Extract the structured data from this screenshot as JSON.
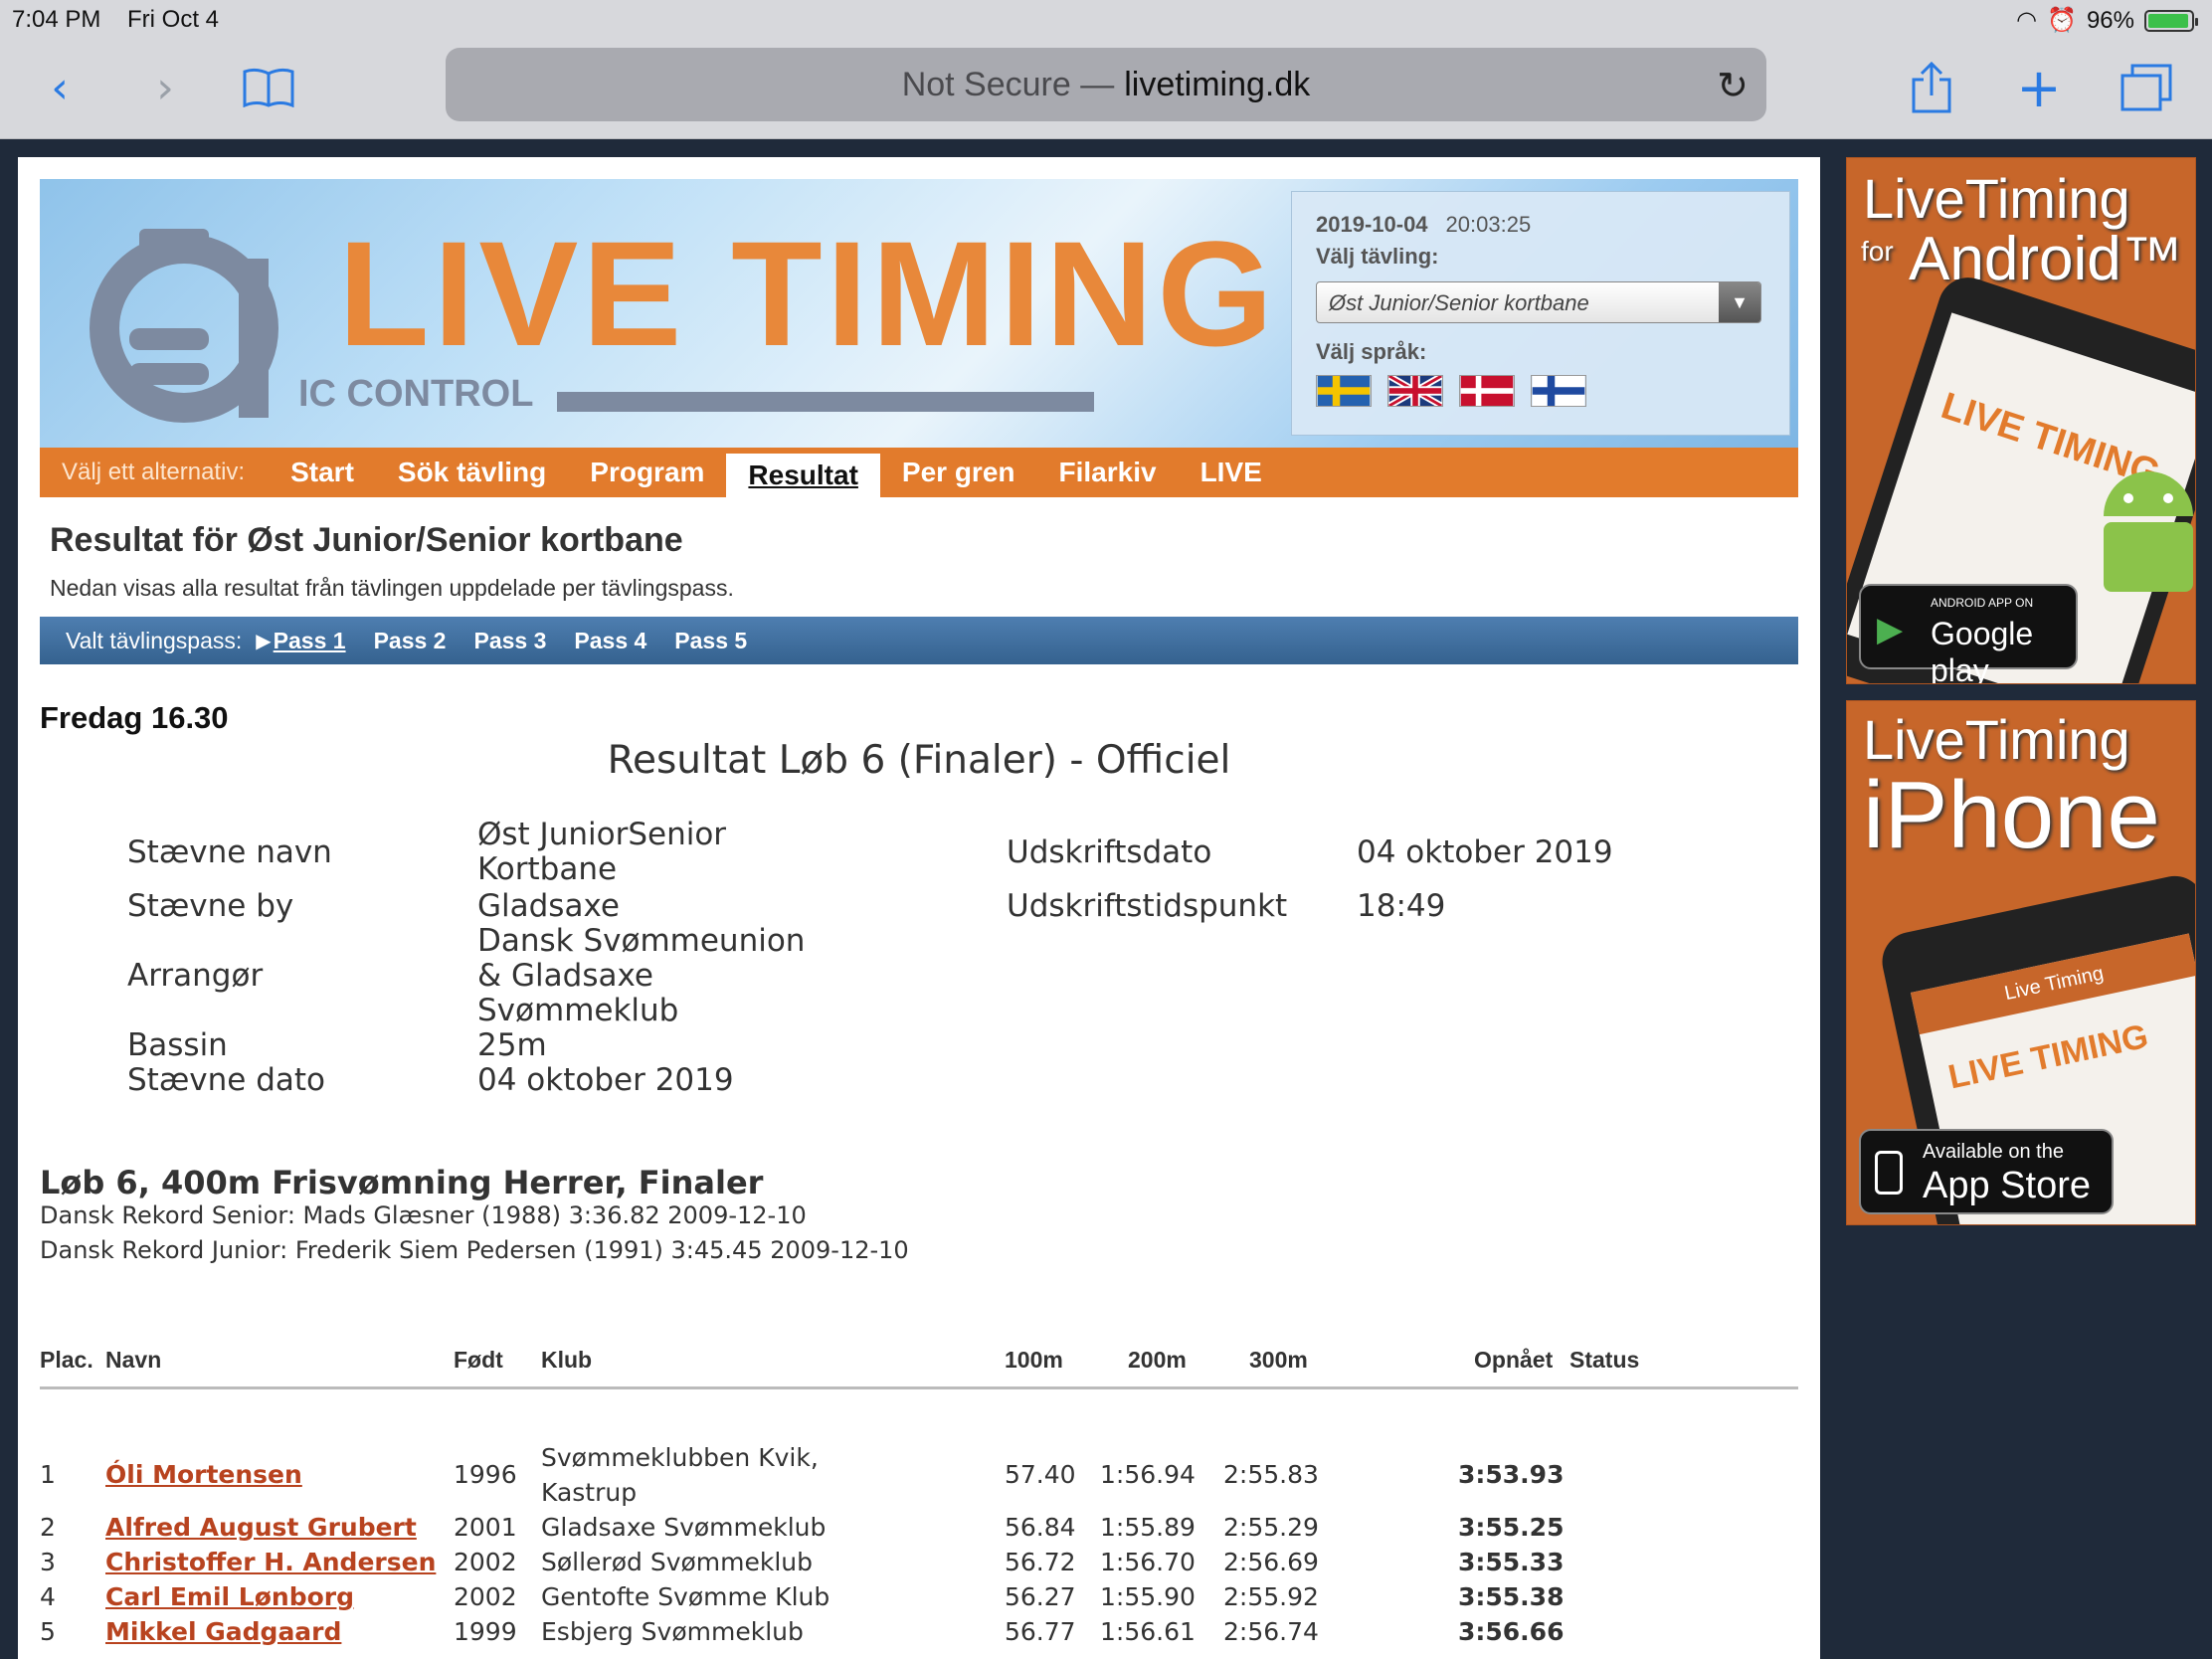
{
  "status_bar": {
    "time": "7:04 PM",
    "date": "Fri Oct 4",
    "battery": "96%",
    "battery_level": 0.96
  },
  "browser": {
    "not_secure": "Not Secure —",
    "domain": "livetiming.dk"
  },
  "header": {
    "brand": "LIVE TIMING",
    "brand_sub": "IC CONTROL",
    "date": "2019-10-04",
    "clock": "20:03:25",
    "choose_competition_label": "Välj tävling:",
    "competition_selected": "Øst Junior/Senior kortbane",
    "choose_language_label": "Välj språk:",
    "languages": [
      "Svenska",
      "English",
      "Dansk",
      "Suomi"
    ]
  },
  "nav": {
    "lead": "Välj ett alternativ:",
    "items": [
      "Start",
      "Sök tävling",
      "Program",
      "Resultat",
      "Per gren",
      "Filarkiv",
      "LIVE"
    ],
    "active": "Resultat"
  },
  "page": {
    "title": "Resultat för Øst Junior/Senior kortbane",
    "subtitle": "Nedan visas alla resultat från tävlingen uppdelade per tävlingspass."
  },
  "pass_bar": {
    "lead": "Valt tävlingspass:",
    "items": [
      "Pass 1",
      "Pass 2",
      "Pass 3",
      "Pass 4",
      "Pass 5"
    ],
    "active": "Pass 1"
  },
  "session": {
    "day": "Fredag 16.30"
  },
  "result": {
    "title": "Resultat Løb 6 (Finaler) - Officiel",
    "meta_left_labels": [
      "Stævne navn",
      "Stævne by",
      "Arrangør",
      "Bassin",
      "Stævne dato"
    ],
    "meta_left_values": [
      "Øst JuniorSenior\nKortbane",
      "Gladsaxe",
      "Dansk Svømmeunion\n& Gladsaxe\nSvømmeklub",
      "25m",
      "04 oktober 2019"
    ],
    "meta_right_labels": [
      "Udskriftsdato",
      "Udskriftstidspunkt"
    ],
    "meta_right_values": [
      "04 oktober 2019",
      "18:49"
    ]
  },
  "event": {
    "title": "Løb 6, 400m Frisvømning Herrer, Finaler",
    "records": [
      "Dansk Rekord Senior: Mads Glæsner (1988) 3:36.82 2009-12-10",
      "Dansk Rekord Junior: Frederik Siem Pedersen (1991) 3:45.45 2009-12-10"
    ]
  },
  "table": {
    "headers": {
      "place": "Plac.",
      "name": "Navn",
      "born": "Født",
      "club": "Klub",
      "s100": "100m",
      "s200": "200m",
      "s300": "300m",
      "result": "Opnået",
      "status": "Status"
    },
    "rows": [
      {
        "place": "1",
        "name": "Óli Mortensen",
        "born": "1996",
        "club": "Svømmeklubben Kvik,\nKastrup",
        "s100": "57.40",
        "s200": "1:56.94",
        "s300": "2:55.83",
        "result": "3:53.93"
      },
      {
        "place": "2",
        "name": "Alfred August Grubert",
        "born": "2001",
        "club": "Gladsaxe Svømmeklub",
        "s100": "56.84",
        "s200": "1:55.89",
        "s300": "2:55.29",
        "result": "3:55.25"
      },
      {
        "place": "3",
        "name": "Christoffer H. Andersen",
        "born": "2002",
        "club": "Søllerød Svømmeklub",
        "s100": "56.72",
        "s200": "1:56.70",
        "s300": "2:56.69",
        "result": "3:55.33"
      },
      {
        "place": "4",
        "name": "Carl Emil Lønborg",
        "born": "2002",
        "club": "Gentofte Svømme Klub",
        "s100": "56.27",
        "s200": "1:55.90",
        "s300": "2:55.92",
        "result": "3:55.38"
      },
      {
        "place": "5",
        "name": "Mikkel Gadgaard",
        "born": "1999",
        "club": "Esbjerg Svømmeklub",
        "s100": "56.77",
        "s200": "1:56.61",
        "s300": "2:56.74",
        "result": "3:56.66"
      }
    ]
  },
  "ads": {
    "android": {
      "line1": "LiveTiming",
      "line2": "Android™",
      "for": "for",
      "badge_small": "ANDROID APP ON",
      "badge_big": "Google play",
      "screen_brand": "LIVE TIMING"
    },
    "iphone": {
      "line1": "LiveTiming",
      "line2": "iPhone",
      "badge_small": "Available on the",
      "badge_big": "App Store",
      "screen_brand": "LIVE TIMING",
      "screen_title": "Live Timing"
    }
  },
  "colors": {
    "accent": "#e27b2c",
    "link": "#b8431f",
    "pass_bar": "#3d6b98"
  }
}
